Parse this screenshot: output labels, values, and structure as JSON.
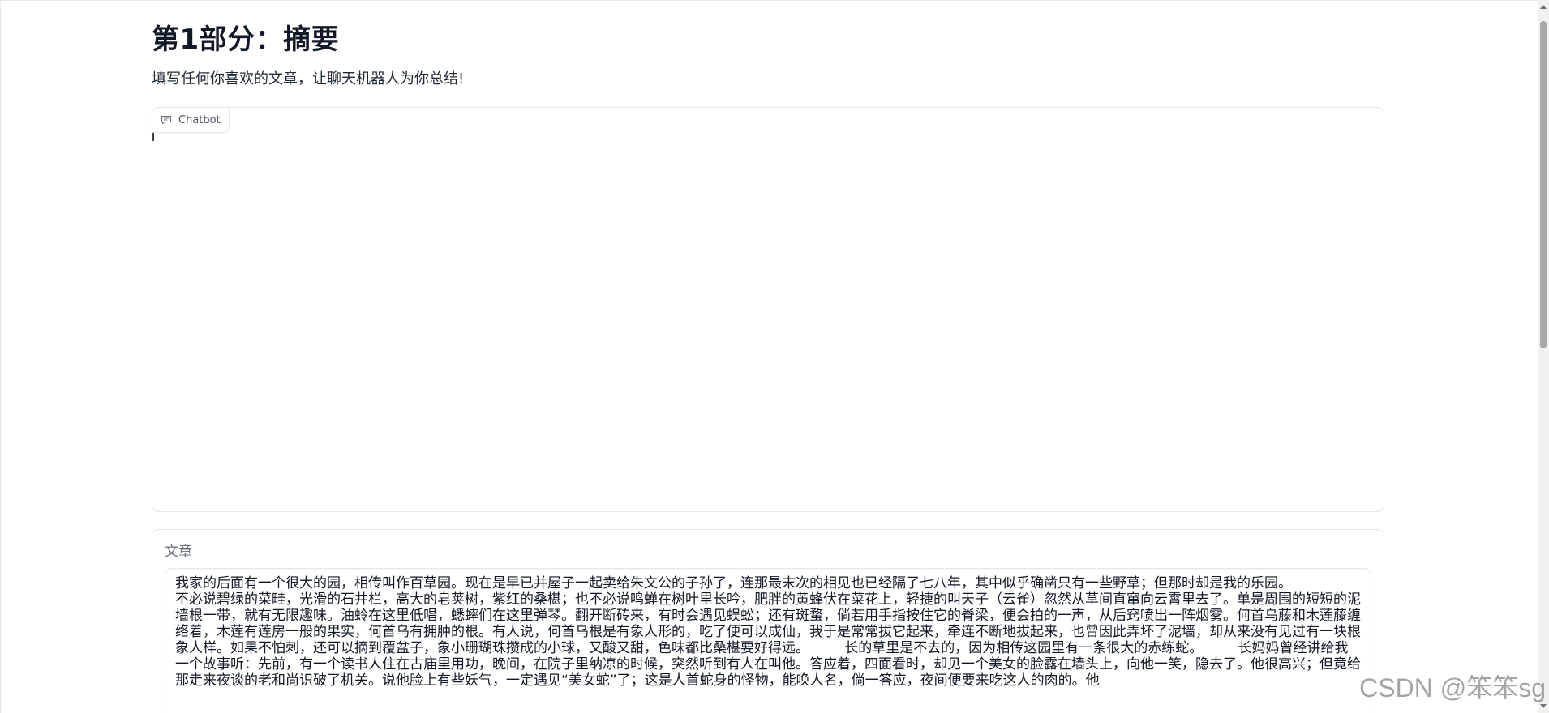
{
  "page": {
    "title": "第1部分：摘要",
    "subtitle": "填写任何你喜欢的文章，让聊天机器人为你总结!"
  },
  "chatbot": {
    "label": "Chatbot",
    "icon": "chat-bubble-icon"
  },
  "article": {
    "label": "文章",
    "value": "我家的后面有一个很大的园，相传叫作百草园。现在是早已并屋子一起卖给朱文公的子孙了，连那最末次的相见也已经隔了七八年，其中似乎确凿只有一些野草；但那时却是我的乐园。\n不必说碧绿的菜畦，光滑的石井栏，高大的皂荚树，紫红的桑椹；也不必说鸣蝉在树叶里长吟，肥胖的黄蜂伏在菜花上，轻捷的叫天子（云雀）忽然从草间直窜向云霄里去了。单是周围的短短的泥墙根一带，就有无限趣味。油蛉在这里低唱，蟋蟀们在这里弹琴。翻开断砖来，有时会遇见蜈蚣；还有斑蝥，倘若用手指按住它的脊梁，便会拍的一声，从后窍喷出一阵烟雾。何首乌藤和木莲藤缠络着，木莲有莲房一般的果实，何首乌有拥肿的根。有人说，何首乌根是有象人形的，吃了便可以成仙，我于是常常拔它起来，牵连不断地拔起来，也曾因此弄坏了泥墙，却从来没有见过有一块根象人样。如果不怕刺，还可以摘到覆盆子，象小珊瑚珠攒成的小球，又酸又甜，色味都比桑椹要好得远。        长的草里是不去的，因为相传这园里有一条很大的赤练蛇。        长妈妈曾经讲给我一个故事听：先前，有一个读书人住在古庙里用功，晚间，在院子里纳凉的时候，突然听到有人在叫他。答应着，四面看时，却见一个美女的脸露在墙头上，向他一笑，隐去了。他很高兴；但竟给那走来夜谈的老和尚识破了机关。说他脸上有些妖气，一定遇见“美女蛇”了；这是人首蛇身的怪物，能唤人名，倘一答应，夜间便要来吃这人的肉的。他"
  },
  "watermark": {
    "text": "CSDN @笨笨sg"
  }
}
